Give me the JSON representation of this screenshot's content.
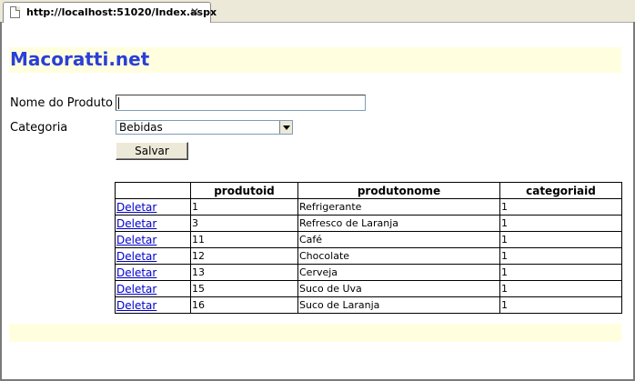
{
  "browser": {
    "tab_title": "http://localhost:51020/Index.aspx",
    "close_glyph": "✕",
    "page_icon": "page-icon"
  },
  "page": {
    "site_title": "Macoratti.net",
    "band_color": "#ffffe0",
    "title_color": "#2a3fd6"
  },
  "form": {
    "product_label": "Nome do Produto",
    "product_value": "",
    "category_label": "Categoria",
    "category_selected": "Bebidas",
    "save_label": "Salvar"
  },
  "table": {
    "headers": [
      "",
      "produtoid",
      "produtonome",
      "categoriaid"
    ],
    "delete_label": "Deletar",
    "rows": [
      {
        "produtoid": "1",
        "produtonome": "Refrigerante",
        "categoriaid": "1"
      },
      {
        "produtoid": "3",
        "produtonome": "Refresco de Laranja",
        "categoriaid": "1"
      },
      {
        "produtoid": "11",
        "produtonome": "Café",
        "categoriaid": "1"
      },
      {
        "produtoid": "12",
        "produtonome": "Chocolate",
        "categoriaid": "1"
      },
      {
        "produtoid": "13",
        "produtonome": "Cerveja",
        "categoriaid": "1"
      },
      {
        "produtoid": "15",
        "produtonome": "Suco de Uva",
        "categoriaid": "1"
      },
      {
        "produtoid": "16",
        "produtonome": "Suco de Laranja",
        "categoriaid": "1"
      }
    ]
  }
}
